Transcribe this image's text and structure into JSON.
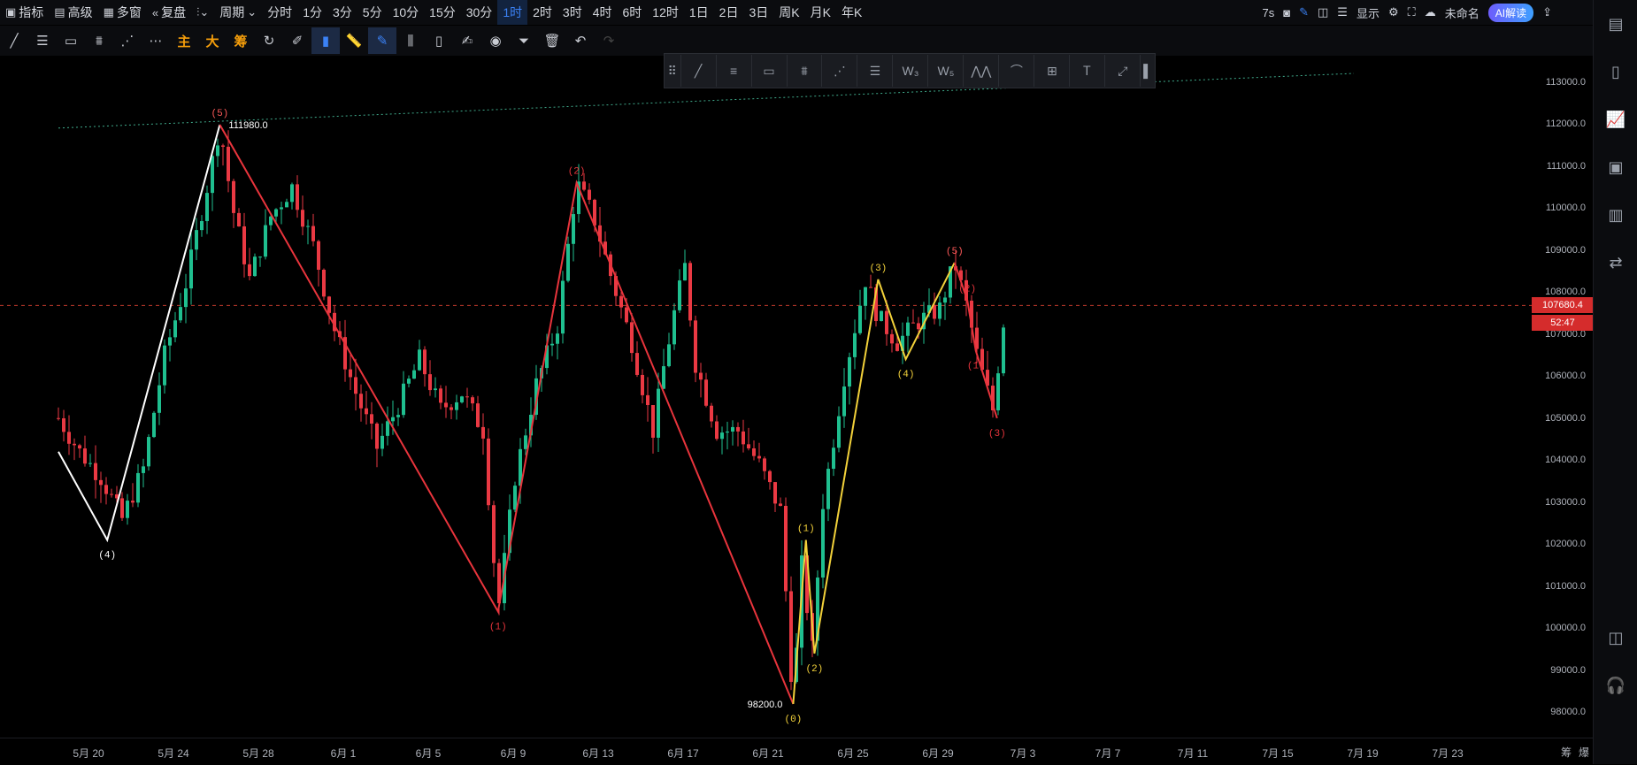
{
  "topbar": {
    "left": [
      {
        "icon": "indicator-icon",
        "label": "指标"
      },
      {
        "icon": "calendar-icon",
        "label": "高级"
      },
      {
        "icon": "grid-icon",
        "label": "多窗"
      },
      {
        "icon": "rewind-icon",
        "label": "复盘"
      },
      {
        "icon": "candle-type-icon",
        "label": ""
      },
      {
        "icon": "",
        "label": "周期"
      }
    ],
    "timeframes": [
      "分时",
      "1分",
      "3分",
      "5分",
      "10分",
      "15分",
      "30分",
      "1时",
      "2时",
      "3时",
      "4时",
      "6时",
      "12时",
      "1日",
      "2日",
      "3日",
      "周K",
      "月K",
      "年K"
    ],
    "active_timeframe": "1时",
    "right": {
      "countdown": "7s",
      "display_label": "显示",
      "save_label": "未命名",
      "ai_label": "AI解读"
    }
  },
  "toolbar2": {
    "text_buttons": [
      "主",
      "大",
      "筹"
    ]
  },
  "chart_data": {
    "type": "candlestick",
    "x_ticks": [
      "5月 20",
      "5月 24",
      "5月 28",
      "6月 1",
      "6月 5",
      "6月 9",
      "6月 13",
      "6月 17",
      "6月 21",
      "6月 25",
      "6月 29",
      "7月 3",
      "7月 7",
      "7月 11",
      "7月 15",
      "7月 19",
      "7月 23"
    ],
    "y_ticks": [
      113000,
      112000,
      111000,
      110000,
      109000,
      108000,
      107000,
      106000,
      105000,
      104000,
      103000,
      102000,
      101000,
      100000,
      99000,
      98000
    ],
    "ylim": [
      97400,
      113600
    ],
    "current_price": "107680.4",
    "countdown": "52:47",
    "high_annotation": "111980.0",
    "low_annotation": "98200.0",
    "price_curve": [
      [
        -1,
        105000
      ],
      [
        0,
        104200
      ],
      [
        1,
        103600
      ],
      [
        2,
        102600
      ],
      [
        3,
        103800
      ],
      [
        4,
        106500
      ],
      [
        5,
        108200
      ],
      [
        6,
        110500
      ],
      [
        6.6,
        111980
      ],
      [
        7.2,
        110000
      ],
      [
        8,
        108300
      ],
      [
        9,
        109800
      ],
      [
        10,
        110500
      ],
      [
        11,
        109100
      ],
      [
        12,
        107100
      ],
      [
        13,
        105600
      ],
      [
        14,
        104300
      ],
      [
        15,
        105300
      ],
      [
        16,
        106400
      ],
      [
        17,
        105200
      ],
      [
        18,
        105600
      ],
      [
        19,
        104700
      ],
      [
        19.7,
        100400
      ],
      [
        20.5,
        103600
      ],
      [
        21.5,
        105800
      ],
      [
        22.5,
        107200
      ],
      [
        23.4,
        110600
      ],
      [
        24.2,
        109800
      ],
      [
        25,
        108400
      ],
      [
        26,
        106800
      ],
      [
        27,
        104700
      ],
      [
        27.5,
        106200
      ],
      [
        28,
        107500
      ],
      [
        28.5,
        108600
      ],
      [
        29,
        106300
      ],
      [
        30,
        104700
      ],
      [
        31,
        104700
      ],
      [
        32,
        103900
      ],
      [
        33,
        102800
      ],
      [
        33.6,
        98200
      ],
      [
        34,
        101500
      ],
      [
        34.5,
        99500
      ],
      [
        35,
        103000
      ],
      [
        36,
        106000
      ],
      [
        37,
        108300
      ],
      [
        37.6,
        107400
      ],
      [
        38.5,
        106800
      ],
      [
        39.5,
        107300
      ],
      [
        40.5,
        107600
      ],
      [
        41.2,
        108700
      ],
      [
        41.8,
        107600
      ],
      [
        42.3,
        106400
      ],
      [
        43,
        105200
      ],
      [
        43.6,
        107700
      ]
    ],
    "waves": [
      {
        "color": "#ffffff",
        "points": [
          [
            -1,
            104200
          ],
          [
            1.3,
            102100
          ],
          [
            6.6,
            111980
          ]
        ],
        "labels": [
          {
            "t": "(4)",
            "i": 1,
            "pos": "below"
          },
          {
            "t": "(5)",
            "i": 2,
            "pos": "above",
            "color": "#ff5a5a"
          }
        ]
      },
      {
        "color": "#e8343c",
        "points": [
          [
            6.6,
            111980
          ],
          [
            19.7,
            100400
          ],
          [
            23.4,
            110600
          ],
          [
            33.6,
            98200
          ]
        ],
        "labels": [
          {
            "t": "(1)",
            "i": 1,
            "pos": "below"
          },
          {
            "t": "(2)",
            "i": 2,
            "pos": "above"
          }
        ]
      },
      {
        "color": "#f2d13a",
        "points": [
          [
            33.6,
            98200
          ],
          [
            34.2,
            102100
          ],
          [
            34.6,
            99400
          ],
          [
            37.6,
            108300
          ],
          [
            38.9,
            106400
          ],
          [
            41.2,
            108700
          ]
        ],
        "labels": [
          {
            "t": "(0)",
            "i": 0,
            "pos": "below"
          },
          {
            "t": "(1)",
            "i": 1,
            "pos": "above"
          },
          {
            "t": "(2)",
            "i": 2,
            "pos": "below"
          },
          {
            "t": "(3)",
            "i": 3,
            "pos": "above"
          },
          {
            "t": "(4)",
            "i": 4,
            "pos": "below"
          },
          {
            "t": "(5)",
            "i": 5,
            "pos": "above",
            "color": "#ff5a5a"
          }
        ]
      },
      {
        "color": "#e8343c",
        "points": [
          [
            41.2,
            108700
          ],
          [
            41.8,
            107800
          ],
          [
            42.2,
            106600
          ],
          [
            43.2,
            105000
          ]
        ],
        "labels": [
          {
            "t": "(2)",
            "i": 1,
            "pos": "above"
          },
          {
            "t": "(1)",
            "i": 2,
            "pos": "below"
          },
          {
            "t": "(3)",
            "i": 3,
            "pos": "below"
          }
        ]
      }
    ],
    "trendline": {
      "color": "#3fa98a",
      "from": [
        -1,
        111900
      ],
      "to": [
        60,
        113200
      ]
    },
    "current_line": {
      "value": 107680,
      "color": "#c0392b"
    }
  },
  "rightbar": {
    "icons": [
      "list-icon",
      "watchlist-icon",
      "chart-icon",
      "monitor-icon",
      "etf-icon",
      "exchange-icon",
      "layout-icon",
      "headset-icon"
    ]
  },
  "corner": {
    "a": "筹",
    "b": "爆"
  }
}
